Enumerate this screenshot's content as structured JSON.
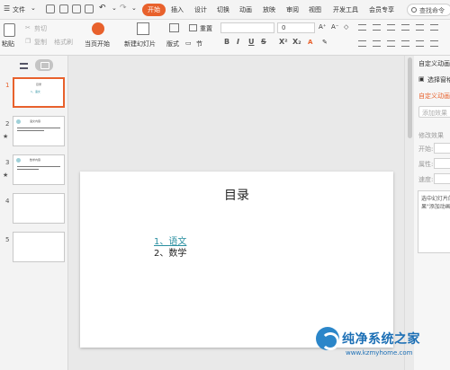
{
  "menubar": {
    "file_label": "文件",
    "tabs": [
      {
        "label": "开始",
        "active": true
      },
      {
        "label": "插入"
      },
      {
        "label": "设计"
      },
      {
        "label": "切换"
      },
      {
        "label": "动画"
      },
      {
        "label": "放映"
      },
      {
        "label": "审阅"
      },
      {
        "label": "视图"
      },
      {
        "label": "开发工具"
      },
      {
        "label": "会员专享"
      }
    ],
    "search_placeholder": "查找命令"
  },
  "ribbon": {
    "paste": "粘贴",
    "cut": "剪切",
    "copy": "复制",
    "format_painter": "格式刷",
    "play_from_current": "当页开始",
    "new_slide": "新建幻灯片",
    "layout": "版式",
    "section": "节",
    "reset": "重置",
    "font_size": "0",
    "format_buttons": [
      "B",
      "I",
      "U",
      "S",
      "X²",
      "X₂"
    ]
  },
  "slides_pane": {
    "thumbnails": [
      {
        "number": "1",
        "active": true,
        "title": "目录",
        "item": "1、语文",
        "star": false
      },
      {
        "number": "2",
        "active": false,
        "title": "语文内容",
        "star": true
      },
      {
        "number": "3",
        "active": false,
        "title": "数学内容",
        "star": true
      },
      {
        "number": "4",
        "active": false,
        "star": false
      },
      {
        "number": "5",
        "active": false,
        "star": false
      }
    ]
  },
  "slide": {
    "title": "目录",
    "items": [
      "1、语文",
      "2、数学"
    ]
  },
  "right_pane": {
    "title": "自定义动画",
    "select_pane": "选择窗格",
    "section_title": "自定义动画",
    "add_effect": "添加效果",
    "modify_effect": "修改效果",
    "start_label": "开始:",
    "property_label": "属性:",
    "speed_label": "速度:",
    "description_line1": "选中幻灯片的某个元素，然后单击",
    "description_line2": "果\"添加动画"
  },
  "watermark": {
    "name": "纯净系统之家",
    "url": "www.kzmyhome.com"
  },
  "colors": {
    "accent": "#e8612c",
    "hyperlink": "#2a8fa0",
    "watermark": "#1c6fb5"
  }
}
